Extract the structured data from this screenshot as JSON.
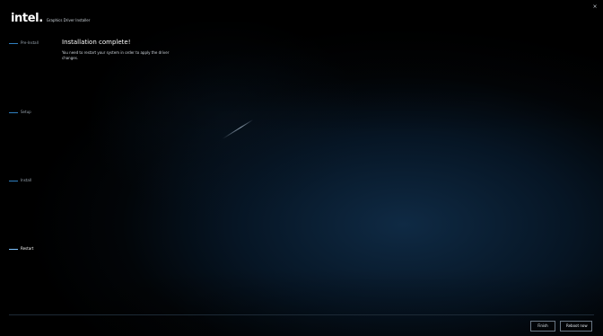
{
  "header": {
    "logo_text": "intel.",
    "app_title": "Graphics Driver Installer"
  },
  "window": {
    "close_glyph": "×"
  },
  "steps": [
    {
      "label": "Pre-Install",
      "active": false
    },
    {
      "label": "Setup",
      "active": false
    },
    {
      "label": "Install",
      "active": false
    },
    {
      "label": "Restart",
      "active": true
    }
  ],
  "content": {
    "title": "Installation complete!",
    "description": "You need to restart your system in order to apply the driver changes."
  },
  "footer": {
    "finish_label": "Finish",
    "reboot_label": "Reboot now"
  },
  "colors": {
    "accent": "#2f7fbf",
    "accent_active": "#7fc3ff",
    "background": "#000000"
  }
}
